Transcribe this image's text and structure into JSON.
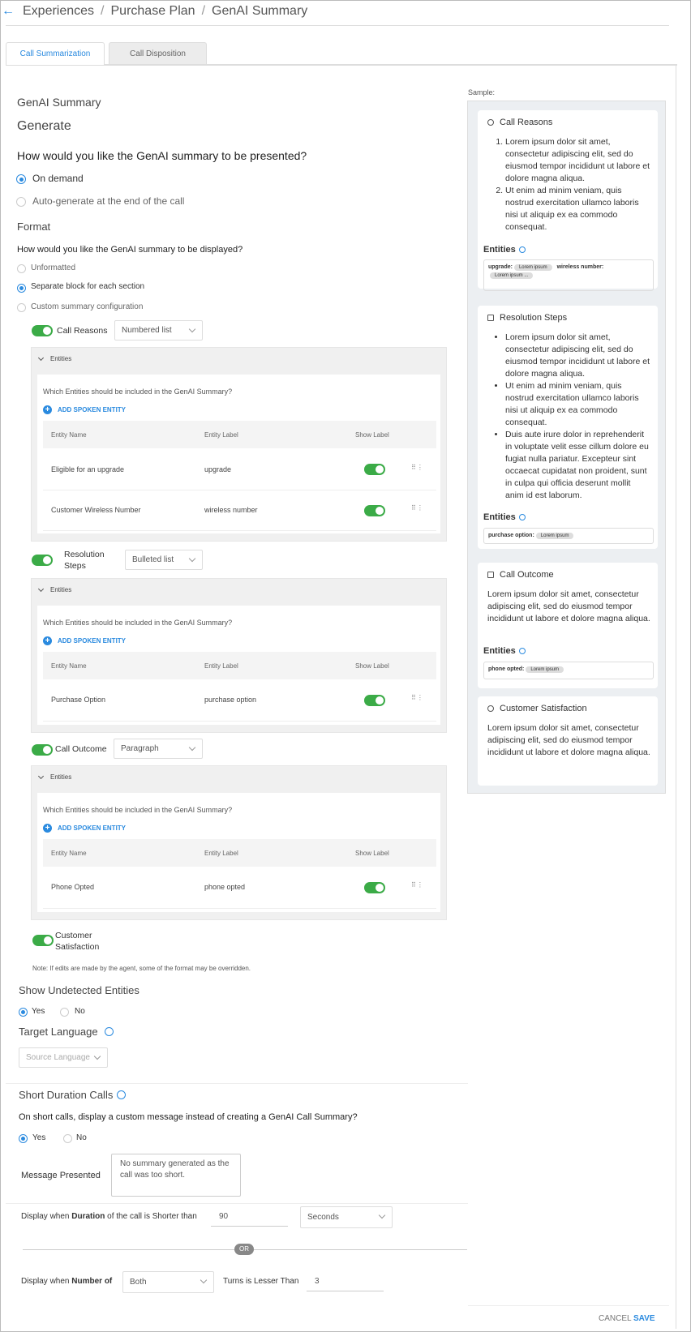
{
  "breadcrumb": {
    "items": [
      "Experiences",
      "Purchase Plan",
      "GenAI Summary"
    ]
  },
  "tabs": [
    {
      "label": "Call Summarization"
    },
    {
      "label": "Call Disposition"
    }
  ],
  "main": {
    "section_title": "GenAI Summary",
    "generate_heading": "Generate",
    "presentation_question": "How would you like the GenAI summary to be presented?",
    "presentation_options": [
      "On demand",
      "Auto-generate at the end of the call"
    ],
    "format_heading": "Format",
    "display_question": "How would you like the GenAI summary to be displayed?",
    "display_options": [
      "Unformatted",
      "Separate block for each section",
      "Custom summary configuration"
    ],
    "entities_label": "Entities",
    "entities_question": "Which Entities should be included in the GenAI Summary?",
    "add_entity_label": "ADD SPOKEN ENTITY",
    "col_headers": [
      "Entity Name",
      "Entity Label",
      "Show Label"
    ],
    "sections": [
      {
        "name": "Call Reasons",
        "format": "Numbered list",
        "rows": [
          {
            "name": "Eligible for an upgrade",
            "label": "upgrade"
          },
          {
            "name": "Customer Wireless Number",
            "label": "wireless number"
          }
        ]
      },
      {
        "name": "Resolution Steps",
        "format": "Bulleted list",
        "rows": [
          {
            "name": "Purchase Option",
            "label": "purchase option"
          }
        ]
      },
      {
        "name": "Call Outcome",
        "format": "Paragraph",
        "rows": [
          {
            "name": "Phone Opted",
            "label": "phone opted"
          }
        ]
      },
      {
        "name": "Customer Satisfaction"
      }
    ],
    "note": "Note: If edits are made by the agent, some of the format may be overridden.",
    "show_undetected": {
      "heading": "Show Undetected Entities",
      "options": [
        "Yes",
        "No"
      ]
    },
    "target_language": {
      "heading": "Target Language",
      "placeholder": "Source Language"
    },
    "short_calls": {
      "heading": "Short Duration Calls",
      "question": "On short calls, display a custom message instead of creating a GenAI Call Summary?",
      "options": [
        "Yes",
        "No"
      ],
      "message_label": "Message Presented",
      "message_value": "No summary generated as the call was too short.",
      "duration_prefix": "Display when ",
      "duration_bold": "Duration",
      "duration_suffix": " of the call is Shorter than",
      "duration_value": "90",
      "duration_unit": "Seconds",
      "or_label": "OR",
      "number_prefix": "Display when ",
      "number_bold": "Number of",
      "number_select": "Both",
      "turns_label": "Turns is Lesser Than",
      "turns_value": "3"
    }
  },
  "sample": {
    "label": "Sample:",
    "entities_label": "Entities",
    "cards": [
      {
        "title": "Call Reasons",
        "items": [
          "Lorem ipsum dolor sit amet, consectetur adipiscing elit, sed do eiusmod tempor incididunt ut labore et dolore magna aliqua.",
          "Ut enim ad minim veniam, quis nostrud exercitation ullamco laboris nisi ut aliquip ex ea commodo consequat."
        ],
        "entities": [
          {
            "key": "upgrade:",
            "chip": "Lorem ipsum"
          },
          {
            "key": "wireless number:",
            "chip": "Lorem ipsum ..."
          }
        ]
      },
      {
        "title": "Resolution Steps",
        "items": [
          "Lorem ipsum dolor sit amet, consectetur adipiscing elit, sed do eiusmod tempor incididunt ut labore et dolore magna aliqua.",
          "Ut enim ad minim veniam, quis nostrud exercitation ullamco laboris nisi ut aliquip ex ea commodo consequat.",
          "Duis aute irure dolor in reprehenderit in voluptate velit esse cillum dolore eu fugiat nulla pariatur. Excepteur sint occaecat cupidatat non proident, sunt in culpa qui officia deserunt mollit anim id est laborum."
        ],
        "entities": [
          {
            "key": "purchase option:",
            "chip": "Lorem ipsum"
          }
        ]
      },
      {
        "title": "Call Outcome",
        "text": "Lorem ipsum dolor sit amet, consectetur adipiscing elit, sed do eiusmod tempor incididunt ut labore et dolore magna aliqua.",
        "entities": [
          {
            "key": "phone opted:",
            "chip": "Lorem ipsum"
          }
        ]
      },
      {
        "title": "Customer Satisfaction",
        "text": "Lorem ipsum dolor sit amet, consectetur adipiscing elit, sed do eiusmod tempor incididunt ut labore et dolore magna aliqua."
      }
    ]
  },
  "footer": {
    "cancel": "CANCEL",
    "save": "SAVE"
  },
  "colors": {
    "accent": "#2a8adf",
    "toggle_on": "#3bab47"
  }
}
